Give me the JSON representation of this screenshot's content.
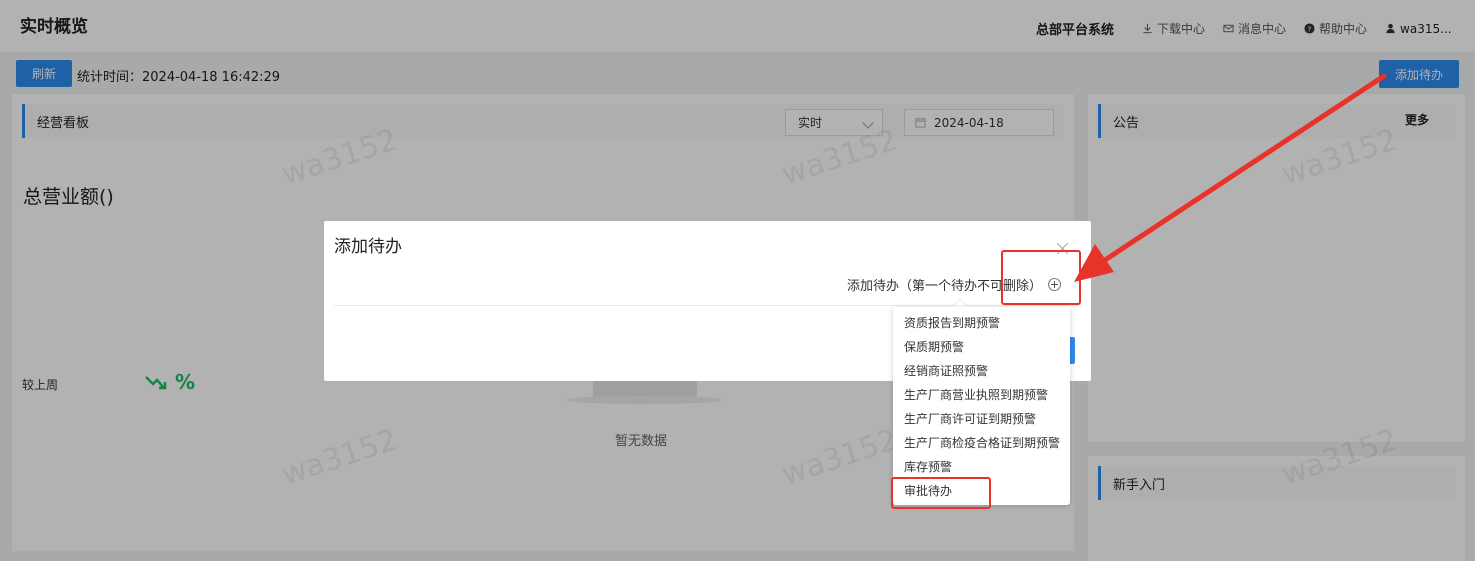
{
  "header": {
    "title": "实时概览",
    "system_name": "总部平台系统",
    "nav": {
      "download": "下载中心",
      "messages": "消息中心",
      "help": "帮助中心",
      "user": "wa315..."
    }
  },
  "toolbar": {
    "refresh_label": "刷新",
    "stat_time": "统计时间：2024-04-18 16:42:29",
    "add_todo_label": "添加待办"
  },
  "dashboard": {
    "title": "经营看板",
    "period_select": "实时",
    "date": "2024-04-18",
    "revenue_title": "总营业额()",
    "compare_label": "较上周",
    "compare_value": "%",
    "empty_text": "暂无数据"
  },
  "notice": {
    "title": "公告",
    "more": "更多"
  },
  "guide": {
    "title": "新手入门"
  },
  "watermark": "wa3152",
  "modal": {
    "title": "添加待办",
    "add_row_label": "添加待办（第一个待办不可删除）"
  },
  "dropdown": {
    "items": [
      "资质报告到期预警",
      "保质期预警",
      "经销商证照预警",
      "生产厂商营业执照到期预警",
      "生产厂商许可证到期预警",
      "生产厂商检疫合格证到期预警",
      "库存预警",
      "审批待办"
    ]
  },
  "colors": {
    "primary": "#2d8cf0",
    "annotation": "#e8332a",
    "trend": "#19be6b"
  }
}
